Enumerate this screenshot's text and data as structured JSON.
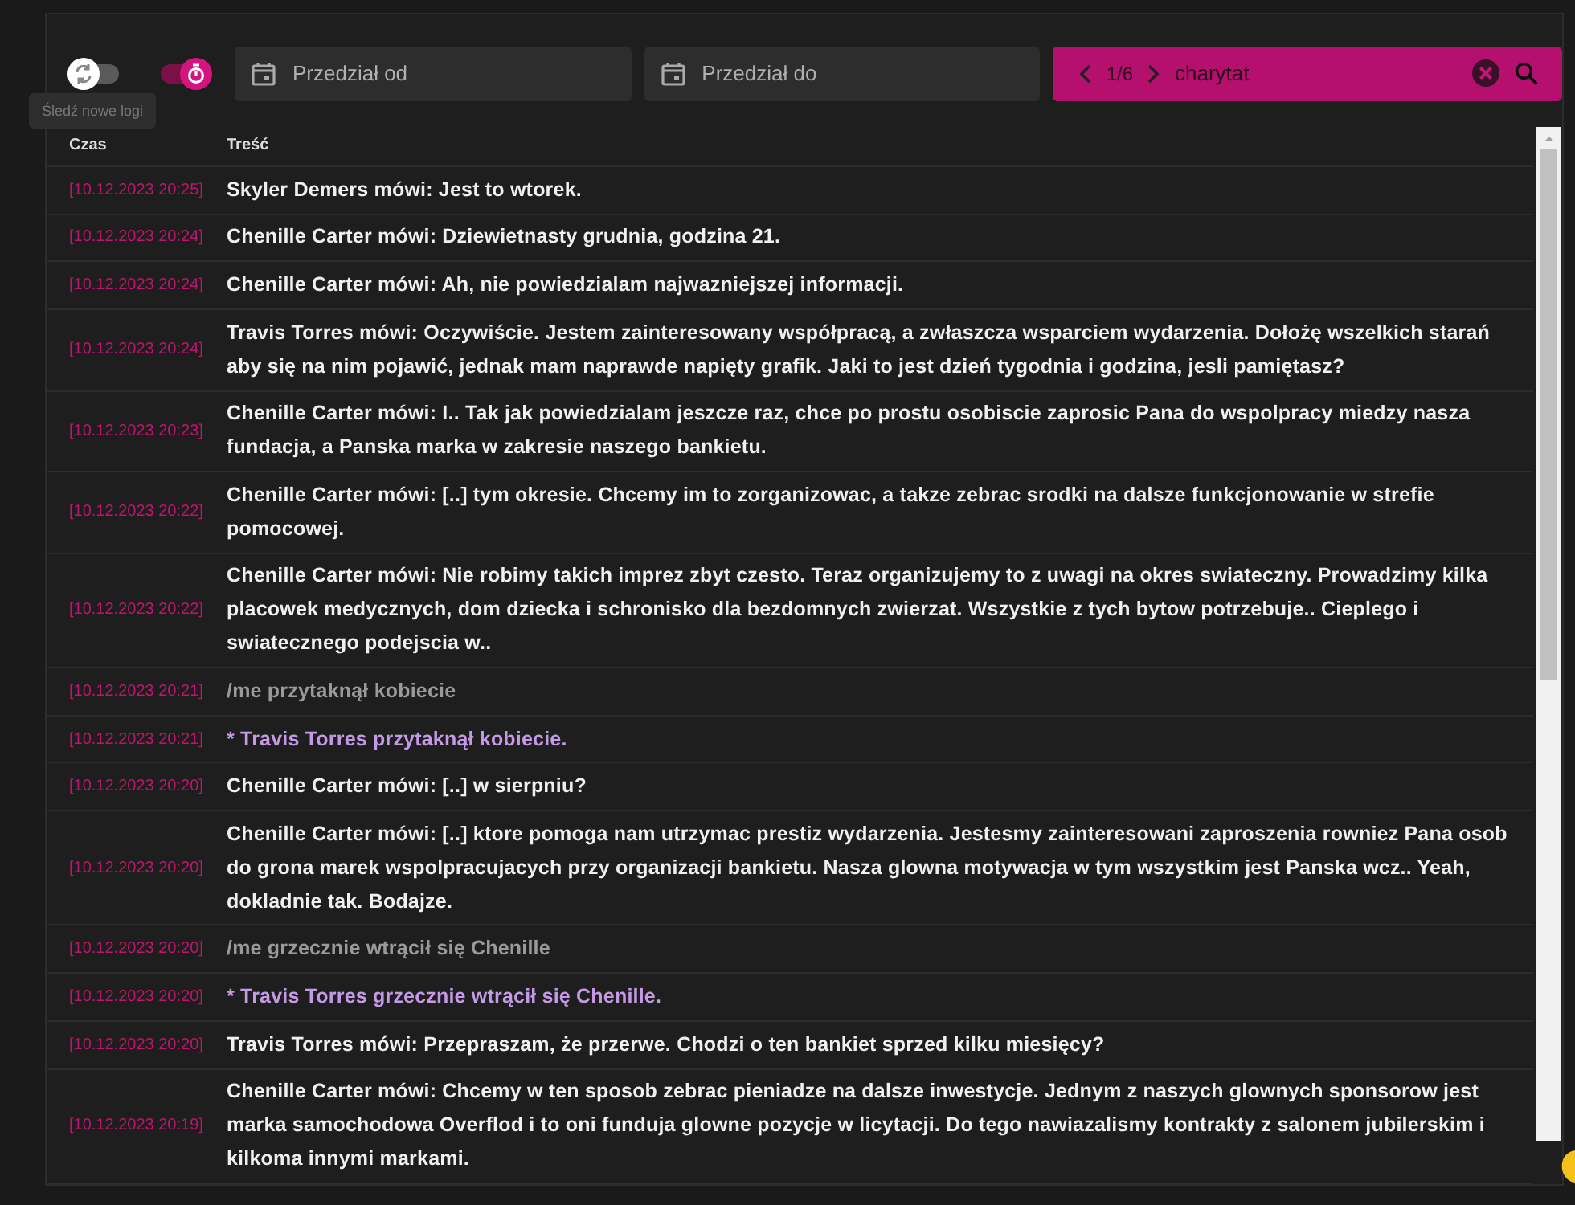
{
  "toolbar": {
    "follow_toggle": {
      "on": false,
      "tooltip": "Śledź nowe logi"
    },
    "timer_toggle": {
      "on": true
    },
    "date_from": {
      "placeholder": "Przedział od"
    },
    "date_to": {
      "placeholder": "Przedział do"
    },
    "search": {
      "counter": "1/6",
      "value": "charytat"
    }
  },
  "table": {
    "columns": [
      "Czas",
      "Treść"
    ],
    "rows": [
      {
        "time": "[10.12.2023 20:25]",
        "kind": "say",
        "text": "Skyler Demers mówi: Jest to wtorek."
      },
      {
        "time": "[10.12.2023 20:24]",
        "kind": "say",
        "text": "Chenille Carter mówi: Dziewietnasty grudnia, godzina 21."
      },
      {
        "time": "[10.12.2023 20:24]",
        "kind": "say",
        "text": "Chenille Carter mówi: Ah, nie powiedzialam najwazniejszej informacji."
      },
      {
        "time": "[10.12.2023 20:24]",
        "kind": "say",
        "text": "Travis Torres mówi: Oczywiście. Jestem zainteresowany współpracą, a zwłaszcza wsparciem wydarzenia. Dołożę wszelkich starań aby się na nim pojawić, jednak mam naprawde napięty grafik. Jaki to jest dzień tygodnia i godzina, jesli pamiętasz?"
      },
      {
        "time": "[10.12.2023 20:23]",
        "kind": "say",
        "text": "Chenille Carter mówi: I.. Tak jak powiedzialam jeszcze raz, chce po prostu osobiscie zaprosic Pana do wspolpracy miedzy nasza fundacja, a Panska marka w zakresie naszego bankietu."
      },
      {
        "time": "[10.12.2023 20:22]",
        "kind": "say",
        "text": "Chenille Carter mówi: [..] tym okresie. Chcemy im to zorganizowac, a takze zebrac srodki na dalsze funkcjonowanie w strefie pomocowej."
      },
      {
        "time": "[10.12.2023 20:22]",
        "kind": "say",
        "text": "Chenille Carter mówi: Nie robimy takich imprez zbyt czesto. Teraz organizujemy to z uwagi na okres swiateczny. Prowadzimy kilka placowek medycznych, dom dziecka i schronisko dla bezdomnych zwierzat. Wszystkie z tych bytow potrzebuje.. Cieplego i swiatecznego podejscia w.."
      },
      {
        "time": "[10.12.2023 20:21]",
        "kind": "command",
        "text": "/me przytaknął kobiecie"
      },
      {
        "time": "[10.12.2023 20:21]",
        "kind": "emote",
        "text": "* Travis Torres przytaknął kobiecie."
      },
      {
        "time": "[10.12.2023 20:20]",
        "kind": "say",
        "text": "Chenille Carter mówi: [..] w sierpniu?"
      },
      {
        "time": "[10.12.2023 20:20]",
        "kind": "say",
        "text": "Chenille Carter mówi: [..] ktore pomoga nam utrzymac prestiz wydarzenia. Jestesmy zainteresowani zaproszenia rowniez Pana osob do grona marek wspolpracujacych przy organizacji bankietu. Nasza glowna motywacja w tym wszystkim jest Panska wcz.. Yeah, dokladnie tak. Bodajze."
      },
      {
        "time": "[10.12.2023 20:20]",
        "kind": "command",
        "text": "/me grzecznie wtrącił się Chenille"
      },
      {
        "time": "[10.12.2023 20:20]",
        "kind": "emote",
        "text": "* Travis Torres grzecznie wtrącił się Chenille."
      },
      {
        "time": "[10.12.2023 20:20]",
        "kind": "say",
        "text": "Travis Torres mówi: Przepraszam, że przerwe. Chodzi o ten bankiet sprzed kilku miesięcy?"
      },
      {
        "time": "[10.12.2023 20:19]",
        "kind": "say",
        "text": "Chenille Carter mówi: Chcemy w ten sposob zebrac pieniadze na dalsze inwestycje. Jednym z naszych glownych sponsorow jest marka samochodowa Overflod i to oni funduja glowne pozycje w licytacji. Do tego nawiazalismy kontrakty z salonem jubilerskim i kilkoma innymi markami."
      }
    ]
  }
}
